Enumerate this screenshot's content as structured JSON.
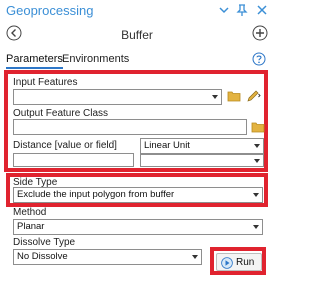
{
  "app": {
    "title": "Geoprocessing"
  },
  "colors": {
    "accent": "#3b8fd6",
    "highlight": "#e0232f",
    "field_border": "#8e8e8e"
  },
  "tool": {
    "title": "Buffer"
  },
  "tabs": [
    {
      "label": "Parameters",
      "active": true
    },
    {
      "label": "Environments",
      "active": false
    }
  ],
  "params": {
    "input_features": {
      "label": "Input Features",
      "value": ""
    },
    "output_feature_class": {
      "label": "Output Feature Class",
      "value": ""
    },
    "distance": {
      "label": "Distance [value or field]",
      "value": "",
      "unit": "Linear Unit",
      "unit_value": ""
    },
    "side_type": {
      "label": "Side Type",
      "value": "Exclude the input polygon from buffer"
    },
    "method": {
      "label": "Method",
      "value": "Planar"
    },
    "dissolve_type": {
      "label": "Dissolve Type",
      "value": "No Dissolve"
    }
  },
  "footer": {
    "run_label": "Run"
  },
  "icons": [
    "pin-icon",
    "minimize-icon",
    "close-icon",
    "back-icon",
    "add-icon",
    "help-icon",
    "folder-icon",
    "edit-pencil-icon",
    "run-icon",
    "dropdown-caret-icon"
  ]
}
